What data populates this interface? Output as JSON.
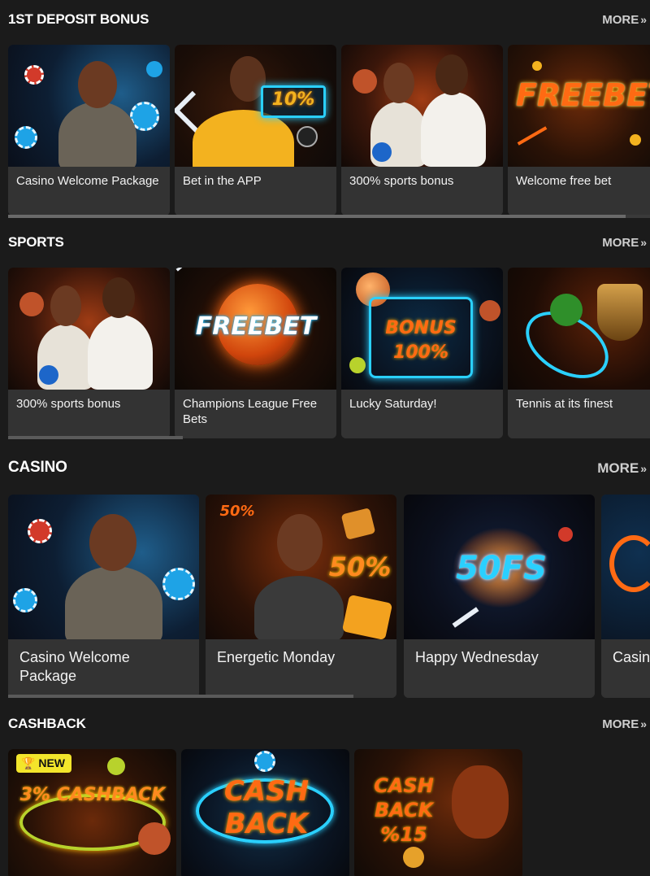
{
  "sections": [
    {
      "title": "1ST DEPOSIT BONUS",
      "more": "MORE",
      "cards": [
        {
          "label": "Casino Welcome Package"
        },
        {
          "label": "Bet in the APP",
          "art_text": "10%"
        },
        {
          "label": "300% sports bonus"
        },
        {
          "label": "Welcome free bet",
          "art_text": "FREEBET"
        }
      ]
    },
    {
      "title": "SPORTS",
      "more": "MORE",
      "cards": [
        {
          "label": "300% sports bonus"
        },
        {
          "label": "Champions League Free Bets",
          "art_text": "FREEBET"
        },
        {
          "label": "Lucky Saturday!",
          "art_text": "BONUS 100%"
        },
        {
          "label": "Tennis at its finest"
        }
      ]
    },
    {
      "title": "CASINO",
      "more": "MORE",
      "cards": [
        {
          "label": "Casino Welcome Package"
        },
        {
          "label": "Energetic Monday",
          "art_text": "50%"
        },
        {
          "label": "Happy Wednesday",
          "art_text": "50FS"
        },
        {
          "label": "Casin Cash"
        }
      ]
    },
    {
      "title": "CASHBACK",
      "more": "MORE",
      "cards": [
        {
          "badge": "NEW",
          "art_text": "3% CASHBACK"
        },
        {
          "art_text": "CASH BACK"
        },
        {
          "art_text": "CASH BACK %15"
        }
      ]
    }
  ],
  "colors": {
    "background": "#1b1b1b",
    "card_caption": "#333333",
    "accent_orange": "#ff6a13",
    "accent_blue": "#2ad0ff",
    "badge_yellow": "#f3e52b"
  },
  "icons": {
    "more": "chevron-double-right-icon",
    "badge": "trophy-icon"
  }
}
